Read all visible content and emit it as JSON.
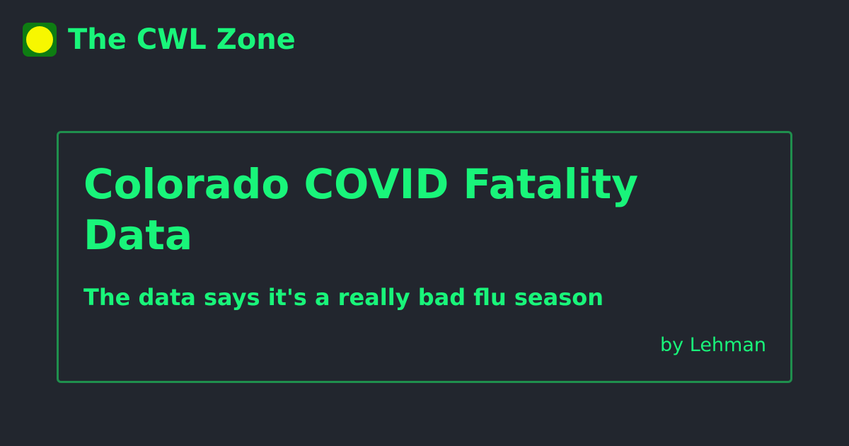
{
  "brand": {
    "name": "The CWL Zone",
    "logo_icon": "yellow-circle-icon",
    "logo_background": "#0e7d12",
    "logo_dot_color": "#f7f700"
  },
  "card": {
    "title": "Colorado COVID Fatality Data",
    "subtitle": "The data says it's a really bad flu season",
    "author": "by Lehman"
  },
  "colors": {
    "background": "#22262e",
    "text": "#19f57a",
    "border": "#1f8f4d"
  }
}
